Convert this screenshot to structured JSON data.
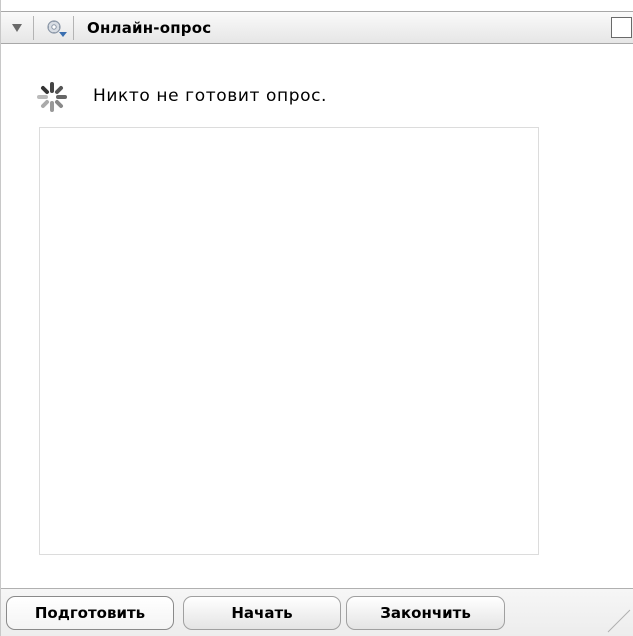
{
  "window": {
    "title": "Онлайн-опрос",
    "icons": {
      "collapse": "collapse-triangle-icon",
      "settings": "settings-dropdown-icon",
      "maximize": "maximize-icon",
      "status": "loading-spinner-icon"
    }
  },
  "main": {
    "status_text": "Никто не готовит опрос."
  },
  "footer": {
    "buttons": [
      {
        "label": "Подготовить",
        "active": true
      },
      {
        "label": "Начать",
        "active": false
      },
      {
        "label": "Закончить",
        "active": false
      }
    ]
  }
}
